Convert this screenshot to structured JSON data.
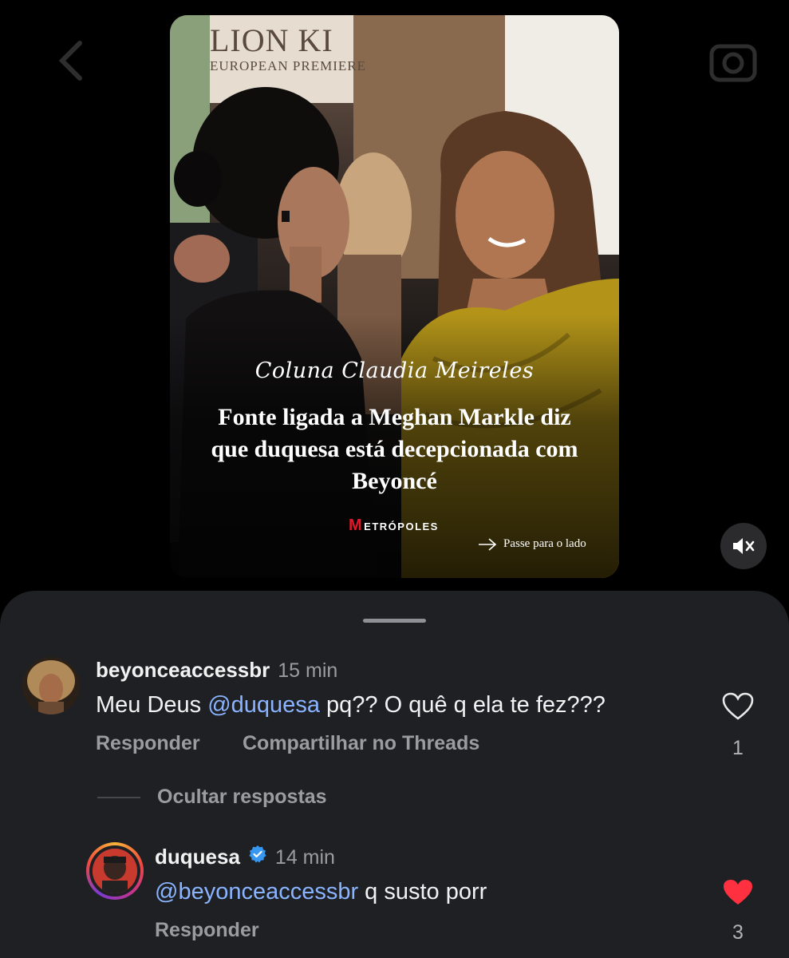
{
  "post": {
    "premiere_title": "LION KI",
    "premiere_subtitle": "EUROPEAN PREMIERE",
    "column_title": "Coluna Claudia Meireles",
    "headline": "Fonte ligada a Meghan Markle diz que duquesa está decepcionada com Beyoncé",
    "brand_m": "M",
    "brand_rest": "ETRÓPOLES",
    "swipe_label": "Passe para o lado",
    "mute_icon": "speaker-muted-icon"
  },
  "comments": [
    {
      "username": "beyonceaccessbr",
      "time": "15 min",
      "text_prefix": "Meu Deus ",
      "mention": "@duquesa",
      "text_suffix": " pq?? O quê q ela te fez???",
      "reply_label": "Responder",
      "share_label": "Compartilhar no Threads",
      "likes": "1",
      "liked": false
    }
  ],
  "hide_replies_label": "Ocultar respostas",
  "replies": [
    {
      "username": "duquesa",
      "verified": true,
      "time": "14 min",
      "mention": "@beyonceaccessbr",
      "text_suffix": " q susto porr",
      "reply_label": "Responder",
      "likes": "3",
      "liked": true
    }
  ],
  "colors": {
    "sheet_bg": "#1e2024",
    "mention": "#8ab4ff",
    "liked_heart": "#ff3040",
    "brand_red": "#e0192b"
  }
}
